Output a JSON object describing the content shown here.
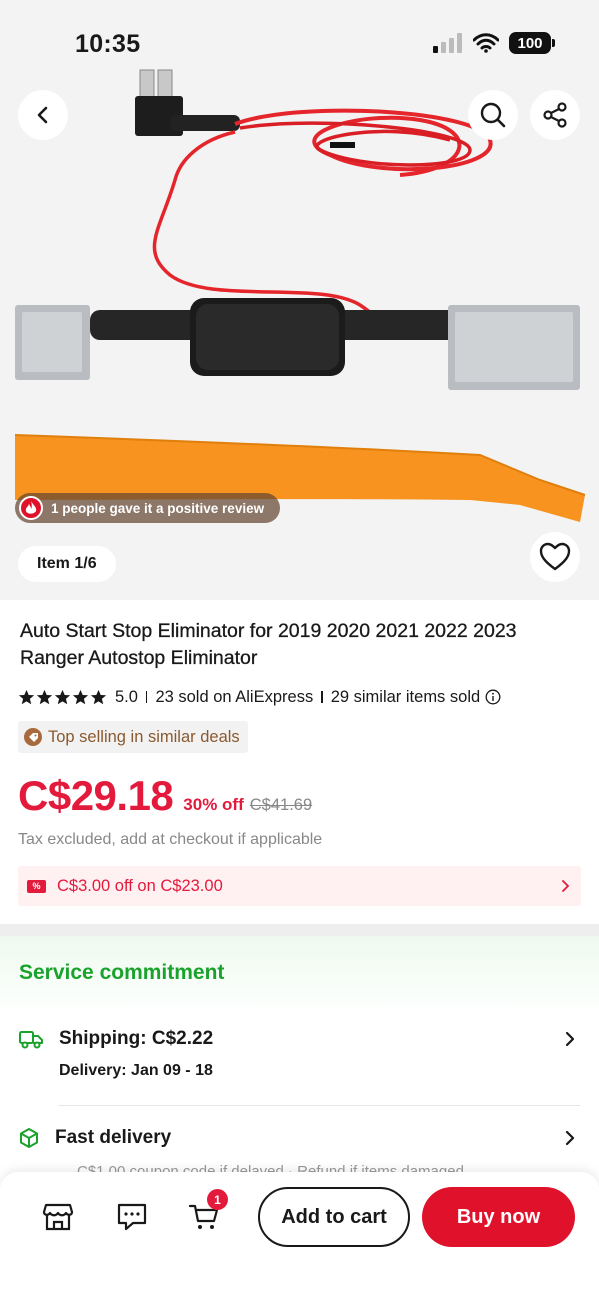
{
  "status_bar": {
    "time": "10:35",
    "battery": "100"
  },
  "hero": {
    "review_badge": "1 people gave it a positive review",
    "item_indicator": "Item 1/6"
  },
  "product": {
    "title": "Auto Start Stop Eliminator for 2019 2020 2021 2022 2023 Ranger Autostop Eliminator",
    "rating": "5.0",
    "sold": "23 sold on AliExpress",
    "similar_sold": "29 similar items sold",
    "stars": 5,
    "top_selling_badge": "Top selling in similar deals",
    "price": "C$29.18",
    "discount": "30% off",
    "original_price": "C$41.69",
    "tax_note": "Tax excluded, add at checkout if applicable",
    "coupon_tag": "%",
    "coupon": "C$3.00 off on C$23.00"
  },
  "service": {
    "title": "Service commitment",
    "shipping_label": "Shipping: C$2.22",
    "delivery": "Delivery: Jan 09 - 18",
    "fast_delivery": "Fast delivery",
    "fast_delivery_detail": "C$1.00 coupon code if delayed · Refund if items damaged"
  },
  "bottom_bar": {
    "cart_count": "1",
    "add_to_cart": "Add to cart",
    "buy_now": "Buy now"
  },
  "colors": {
    "accent_red": "#e41a3d",
    "service_green": "#1aa32c",
    "badge_brown": "#8a5a2f"
  },
  "icons": [
    "back-arrow-icon",
    "search-icon",
    "share-icon",
    "heart-icon",
    "flame-icon",
    "star-icon",
    "info-icon",
    "tag-icon",
    "chevron-right-icon",
    "truck-icon",
    "box-icon",
    "store-icon",
    "message-icon",
    "cart-icon",
    "wifi-icon",
    "signal-icon",
    "battery-icon"
  ]
}
